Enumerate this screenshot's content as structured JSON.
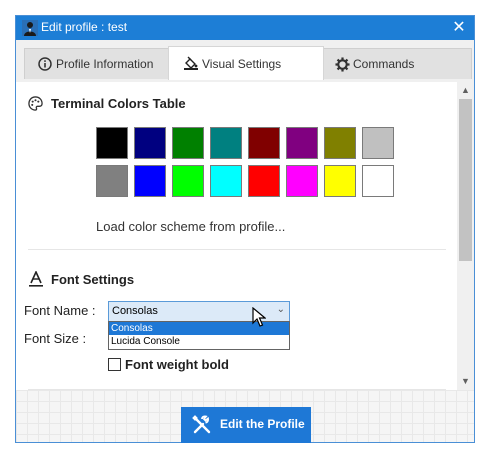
{
  "window": {
    "title": "Edit profile : test",
    "close_glyph": "✕"
  },
  "tabs": [
    {
      "label": "Profile Information",
      "icon": "info-icon",
      "active": false
    },
    {
      "label": "Visual Settings",
      "icon": "paint-bucket-icon",
      "active": true
    },
    {
      "label": "Commands",
      "icon": "gear-icon",
      "active": false
    }
  ],
  "terminal_colors": {
    "title": "Terminal Colors Table",
    "icon": "palette-icon",
    "colors_row1": [
      "#000000",
      "#000080",
      "#008000",
      "#008080",
      "#800000",
      "#800080",
      "#808000",
      "#c0c0c0"
    ],
    "colors_row2": [
      "#808080",
      "#0000ff",
      "#00ff00",
      "#00ffff",
      "#ff0000",
      "#ff00ff",
      "#ffff00",
      "#ffffff"
    ],
    "load_scheme": "Load color scheme from profile..."
  },
  "font_settings": {
    "title": "Font Settings",
    "icon": "font-icon",
    "font_name_label": "Font Name :",
    "font_size_label": "Font Size :",
    "font_name_value": "Consolas",
    "options": [
      "Consolas",
      "Lucida Console"
    ],
    "bold_label": "Font weight bold",
    "bold_checked": false
  },
  "footer": {
    "edit_button": "Edit the Profile"
  },
  "accent_color": "#1e78d6"
}
